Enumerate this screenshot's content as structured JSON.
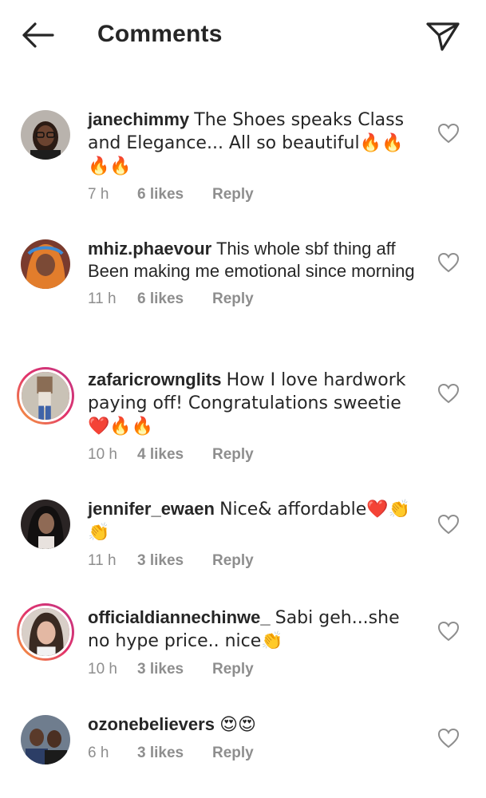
{
  "header": {
    "title": "Comments",
    "back_icon": "arrow-left-icon",
    "share_icon": "paper-plane-icon"
  },
  "comments": [
    {
      "username": "janechimmy",
      "text": "The Shoes speaks Class and Elegance... All so beautiful🔥🔥🔥🔥",
      "time": "7 h",
      "likes": "6 likes",
      "reply": "Reply"
    },
    {
      "username": "mhiz.phaevour",
      "text": "This whole sbf thing aff Been making me emotional since morning",
      "time": "11 h",
      "likes": "6 likes",
      "reply": "Reply"
    },
    {
      "username": "zafaricrownglits",
      "text": "How I love hardwork paying off! Congratulations sweetie ❤️🔥🔥",
      "time": "10 h",
      "likes": "4 likes",
      "reply": "Reply"
    },
    {
      "username": "jennifer_ewaen",
      "text": "Nice& affordable❤️👏👏",
      "time": "11 h",
      "likes": "3 likes",
      "reply": "Reply"
    },
    {
      "username": "officialdiannechinwe_",
      "text": "Sabi geh...she no hype price.. nice👏",
      "time": "10 h",
      "likes": "3 likes",
      "reply": "Reply"
    },
    {
      "username": "ozonebelievers",
      "text": "😍😍",
      "time": "6 h",
      "likes": "3 likes",
      "reply": "Reply"
    }
  ],
  "colors": {
    "text": "#262626",
    "secondary": "#8e8e8e",
    "story_ring": "#e2336b"
  }
}
